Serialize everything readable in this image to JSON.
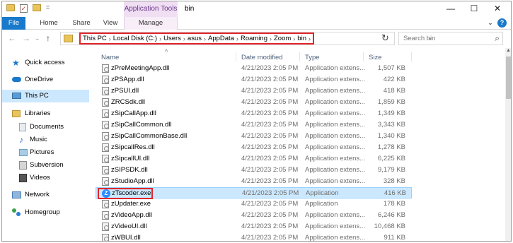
{
  "titlebar": {
    "context_tab": "Application Tools",
    "window_title": "bin",
    "minimize": "—",
    "maximize": "☐",
    "close": "✕"
  },
  "ribbon": {
    "tabs": [
      "File",
      "Home",
      "Share",
      "View",
      "Manage"
    ],
    "help": "?",
    "collapse": "⌄"
  },
  "address": {
    "back": "←",
    "forward": "→",
    "recent": "⌄",
    "up": "↑",
    "crumbs": [
      "This PC",
      "Local Disk (C:)",
      "Users",
      "asus",
      "AppData",
      "Roaming",
      "Zoom",
      "bin"
    ],
    "separator": "›",
    "dropdown": "⌄",
    "refresh": "↻",
    "search_placeholder": "Search bin",
    "search_icon": "⌕"
  },
  "nav": {
    "items": [
      {
        "label": "Quick access",
        "icon": "star-icon",
        "color": "#1979ca"
      },
      {
        "label": "OneDrive",
        "icon": "cloud-icon",
        "color": "#1979ca"
      },
      {
        "label": "This PC",
        "icon": "computer-icon",
        "color": "#5b9bd5",
        "selected": true
      },
      {
        "label": "Libraries",
        "icon": "libraries-icon",
        "color": "#e8c45a"
      },
      {
        "label": "Documents",
        "icon": "documents-icon",
        "color": "#9aa7b5"
      },
      {
        "label": "Music",
        "icon": "music-icon",
        "color": "#3a7bd5"
      },
      {
        "label": "Pictures",
        "icon": "pictures-icon",
        "color": "#6aa0c8"
      },
      {
        "label": "Subversion",
        "icon": "subversion-icon",
        "color": "#8a8a8a"
      },
      {
        "label": "Videos",
        "icon": "videos-icon",
        "color": "#555555"
      },
      {
        "label": "Network",
        "icon": "network-icon",
        "color": "#4a7fb5"
      },
      {
        "label": "Homegroup",
        "icon": "homegroup-icon",
        "color": "#3aa14a"
      }
    ]
  },
  "list": {
    "sort_caret": "^",
    "headers": {
      "name": "Name",
      "date": "Date modified",
      "type": "Type",
      "size": "Size"
    },
    "rows": [
      {
        "name": "zPreMeetingApp.dll",
        "date": "4/21/2023 2:05 PM",
        "type": "Application extens...",
        "size": "1,507 KB"
      },
      {
        "name": "zPSApp.dll",
        "date": "4/21/2023 2:05 PM",
        "type": "Application extens...",
        "size": "422 KB"
      },
      {
        "name": "zPSUI.dll",
        "date": "4/21/2023 2:05 PM",
        "type": "Application extens...",
        "size": "418 KB"
      },
      {
        "name": "ZRCSdk.dll",
        "date": "4/21/2023 2:05 PM",
        "type": "Application extens...",
        "size": "1,859 KB"
      },
      {
        "name": "zSipCallApp.dll",
        "date": "4/21/2023 2:05 PM",
        "type": "Application extens...",
        "size": "1,349 KB"
      },
      {
        "name": "zSipCallCommon.dll",
        "date": "4/21/2023 2:05 PM",
        "type": "Application extens...",
        "size": "3,343 KB"
      },
      {
        "name": "zSipCallCommonBase.dll",
        "date": "4/21/2023 2:05 PM",
        "type": "Application extens...",
        "size": "1,340 KB"
      },
      {
        "name": "zSipcallRes.dll",
        "date": "4/21/2023 2:05 PM",
        "type": "Application extens...",
        "size": "1,278 KB"
      },
      {
        "name": "zSipcallUI.dll",
        "date": "4/21/2023 2:05 PM",
        "type": "Application extens...",
        "size": "6,225 KB"
      },
      {
        "name": "zSIPSDK.dll",
        "date": "4/21/2023 2:05 PM",
        "type": "Application extens...",
        "size": "9,179 KB"
      },
      {
        "name": "zStudioApp.dll",
        "date": "4/21/2023 2:05 PM",
        "type": "Application extens...",
        "size": "328 KB"
      },
      {
        "name": "zTscoder.exe",
        "date": "4/21/2023 2:05 PM",
        "type": "Application",
        "size": "416 KB",
        "selected": true,
        "zoom_icon": true
      },
      {
        "name": "zUpdater.exe",
        "date": "4/21/2023 2:05 PM",
        "type": "Application",
        "size": "178 KB"
      },
      {
        "name": "zVideoApp.dll",
        "date": "4/21/2023 2:05 PM",
        "type": "Application extens...",
        "size": "6,246 KB"
      },
      {
        "name": "zVideoUI.dll",
        "date": "4/21/2023 2:05 PM",
        "type": "Application extens...",
        "size": "10,468 KB"
      },
      {
        "name": "zWBUI.dll",
        "date": "4/21/2023 2:05 PM",
        "type": "Application extens...",
        "size": "911 KB"
      }
    ]
  }
}
